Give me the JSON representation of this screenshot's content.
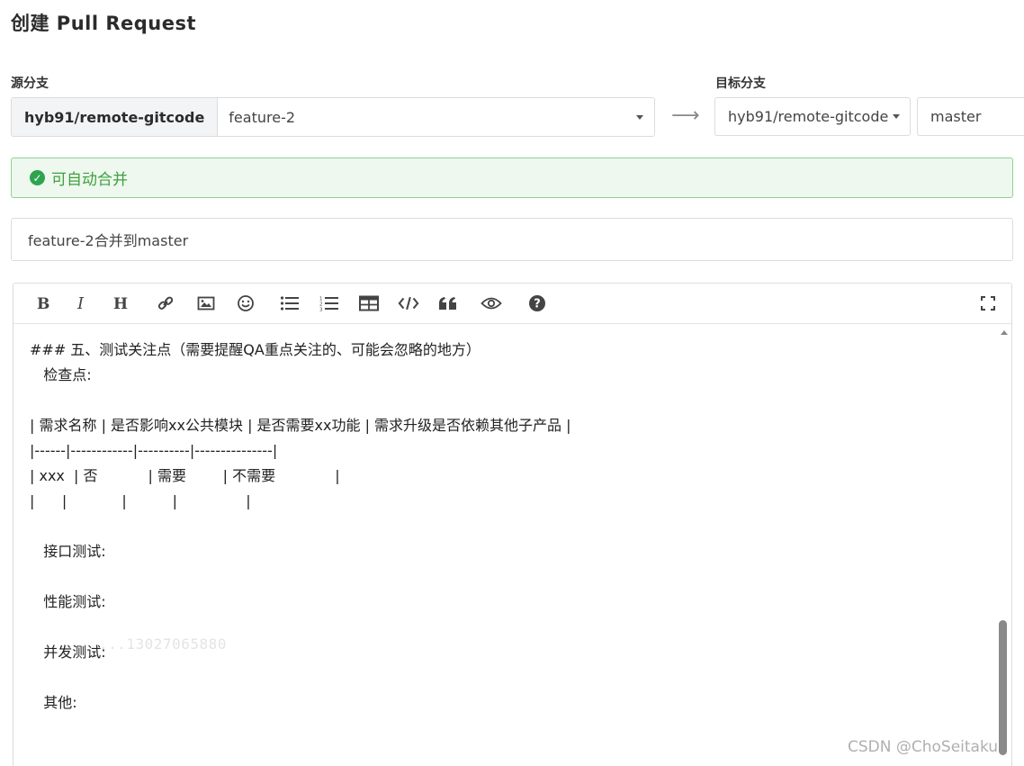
{
  "page": {
    "title": "创建 Pull Request"
  },
  "source": {
    "label": "源分支",
    "repo": "hyb91/remote-gitcode",
    "branch": "feature-2"
  },
  "target": {
    "label": "目标分支",
    "repo": "hyb91/remote-gitcode",
    "branch": "master"
  },
  "merge_status": {
    "text": "可自动合并",
    "color": "#3f9f3f"
  },
  "pr_title": {
    "value": "feature-2合并到master"
  },
  "toolbar": {
    "icons": [
      "bold-icon",
      "italic-icon",
      "heading-icon",
      "link-icon",
      "image-icon",
      "emoji-icon",
      "bullet-list-icon",
      "numbered-list-icon",
      "table-icon",
      "code-icon",
      "quote-icon",
      "preview-icon",
      "help-icon",
      "fullscreen-icon"
    ]
  },
  "editor": {
    "lines": [
      "### 五、测试关注点（需要提醒QA重点关注的、可能会忽略的地方）",
      "   检查点:",
      "",
      "| 需求名称 | 是否影响xx公共模块 | 是否需要xx功能 | 需求升级是否依赖其他子产品 |",
      "|------|------------|----------|---------------|",
      "| xxx  | 否           | 需要        | 不需要             |",
      "|      |            |          |               |",
      "",
      "   接口测试:",
      "",
      "   性能测试:",
      "",
      "   并发测试:",
      "",
      "   其他:"
    ],
    "watermark_code": "...13027065880"
  },
  "watermark": {
    "text": "CSDN @ChoSeitaku"
  }
}
